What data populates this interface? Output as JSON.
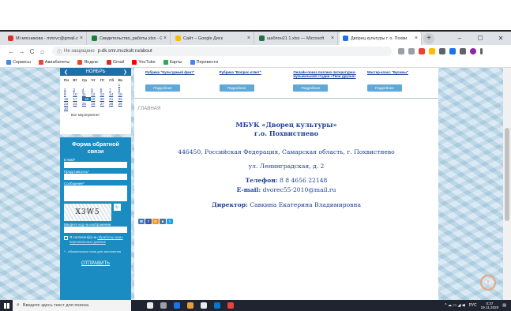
{
  "browser": {
    "tabs": [
      {
        "title": "Mi мясникова - mmrvc@gmail.com",
        "color": "#d93025",
        "active": false
      },
      {
        "title": "Свидетельство_работы.xlsx - G",
        "color": "#188038",
        "active": false
      },
      {
        "title": "Сайт – Google Диск",
        "color": "#fbbc04",
        "active": false
      },
      {
        "title": "шаблон21 1.xlsx — Microsoft",
        "color": "#217346",
        "active": false
      },
      {
        "title": "Дворец культуры г. о. Похви",
        "color": "#1a73e8",
        "active": true
      }
    ],
    "tab_close": "×",
    "new_tab": "+",
    "window_controls": [
      "–",
      "☐",
      "✕"
    ],
    "nav": [
      "←",
      "→",
      "C",
      "⌂"
    ],
    "address": {
      "security_label": "Не защищено",
      "url": "p-dk.smr.muzkult.ru/about"
    },
    "bookmarks": [
      {
        "label": "Сервисы",
        "color": "#4285f4"
      },
      {
        "label": "Авиабилеты",
        "color": "#e8453c"
      },
      {
        "label": "Яндекс",
        "color": "#fc3f1d"
      },
      {
        "label": "Gmail",
        "color": "#d93025"
      },
      {
        "label": "YouTube",
        "color": "#ff0000"
      },
      {
        "label": "Карты",
        "color": "#34a853"
      },
      {
        "label": "Перевести",
        "color": "#4285f4"
      }
    ]
  },
  "calendar": {
    "month": "НОЯБРЬ",
    "prev": "❮",
    "next": "❯",
    "weekdays": [
      "Пн",
      "Вт",
      "Ср",
      "Чт",
      "Пт",
      "Сб",
      "Вс"
    ],
    "days": [
      "",
      "",
      "",
      "",
      "",
      "",
      "1",
      "2",
      "3",
      "4",
      "5",
      "6",
      "7",
      "8",
      "9",
      "10",
      "11",
      "12",
      "13",
      "14",
      "15",
      "16",
      "17",
      "18",
      "19",
      "20",
      "21",
      "22",
      "23",
      "24",
      "25",
      "26",
      "27",
      "28",
      "29",
      "30",
      "",
      "",
      "",
      "",
      "",
      ""
    ],
    "today": "18",
    "footer": "Все мероприятия"
  },
  "form": {
    "title": "Форма обратной связи",
    "email_label": "E-Mail*",
    "name_label": "Представьтесь*",
    "message_label": "Сообщение*",
    "captcha_text": "X3W5",
    "captcha_label": "Введите код на изображении",
    "consent_text": "Я согласен(а) на",
    "consent_link": "обработку моих персональных данных",
    "required_note": "* - обязательные поля для заполнения",
    "submit": "ОТПРАВИТЬ"
  },
  "cards": [
    {
      "title": "Рубрика \"Культурный фант\"",
      "button": "Подробнее"
    },
    {
      "title": "Рубрика \"Вопрос-ответ\"",
      "button": "Подробнее"
    },
    {
      "title": "Онлайн-показ поэтико литературно-музыкальной студии «Твои друзья»",
      "button": "Подробнее"
    },
    {
      "title": "Мастер-класс \"Бусины\"",
      "button": "Подробнее"
    }
  ],
  "breadcrumb": "ГЛАВНАЯ",
  "org": {
    "name": "МБУК «Дворец культуры»",
    "city": "г.о. Похвистнево",
    "address": "446450, Российская Федерация, Самарская область, г. Похвистнево",
    "street": "ул. Ленинградская, д.  2",
    "phone_label": "Телефон:",
    "phone": "8 8 4656 22148",
    "email_label": "E-mail:",
    "email": "dvorec55-2010@mail.ru",
    "director_label": "Директор:",
    "director": "Савкина Екатерина Владимировна"
  },
  "social": [
    {
      "label": "✉",
      "color": "#3b7bbf"
    },
    {
      "label": "f",
      "color": "#3b5998"
    },
    {
      "label": "O",
      "color": "#f7931e"
    },
    {
      "label": "в",
      "color": "#4c75a3"
    },
    {
      "label": "t",
      "color": "#1da1f2"
    }
  ],
  "taskbar": {
    "search_placeholder": "Введите здесь текст для поиска",
    "language": "РУС",
    "time": "0:37",
    "date": "19.11.2020",
    "apps": [
      "#e8eaed",
      "#9aa0a6",
      "#1a73e8",
      "#e2a03f",
      "#e8eaed",
      "#0078d4",
      "#ea4335"
    ]
  },
  "scroll_top": "↑"
}
